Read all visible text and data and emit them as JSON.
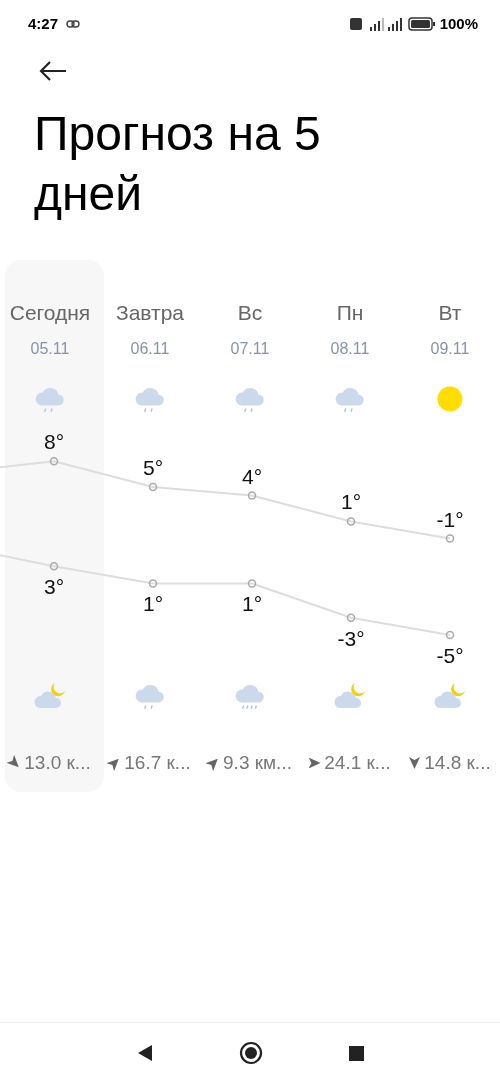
{
  "status_bar": {
    "time": "4:27",
    "battery": "100%"
  },
  "title": "Прогноз на 5 дней",
  "days": [
    {
      "name": "Сегодня",
      "date": "05.11",
      "day_weather": {
        "kind": "rain"
      },
      "high": "8°",
      "low": "3°",
      "night_weather": {
        "kind": "cloud-moon"
      },
      "wind_arrow": {
        "kind": "southeast"
      },
      "wind": "13.0 к...",
      "selected": true
    },
    {
      "name": "Завтра",
      "date": "06.11",
      "day_weather": {
        "kind": "rain"
      },
      "high": "5°",
      "low": "1°",
      "night_weather": {
        "kind": "rain"
      },
      "wind_arrow": {
        "kind": "northeast"
      },
      "wind": "16.7 к...",
      "selected": false
    },
    {
      "name": "Вс",
      "date": "07.11",
      "day_weather": {
        "kind": "rain"
      },
      "high": "4°",
      "low": "1°",
      "night_weather": {
        "kind": "heavy-rain"
      },
      "wind_arrow": {
        "kind": "northeast"
      },
      "wind": "9.3 км...",
      "selected": false
    },
    {
      "name": "Пн",
      "date": "08.11",
      "day_weather": {
        "kind": "rain"
      },
      "high": "1°",
      "low": "-3°",
      "night_weather": {
        "kind": "cloud-moon"
      },
      "wind_arrow": {
        "kind": "east"
      },
      "wind": "24.1 к...",
      "selected": false
    },
    {
      "name": "Вт",
      "date": "09.11",
      "day_weather": {
        "kind": "sun"
      },
      "high": "-1°",
      "low": "-5°",
      "night_weather": {
        "kind": "cloud-moon"
      },
      "wind_arrow": {
        "kind": "south"
      },
      "wind": "14.8 к...",
      "selected": false
    }
  ]
}
